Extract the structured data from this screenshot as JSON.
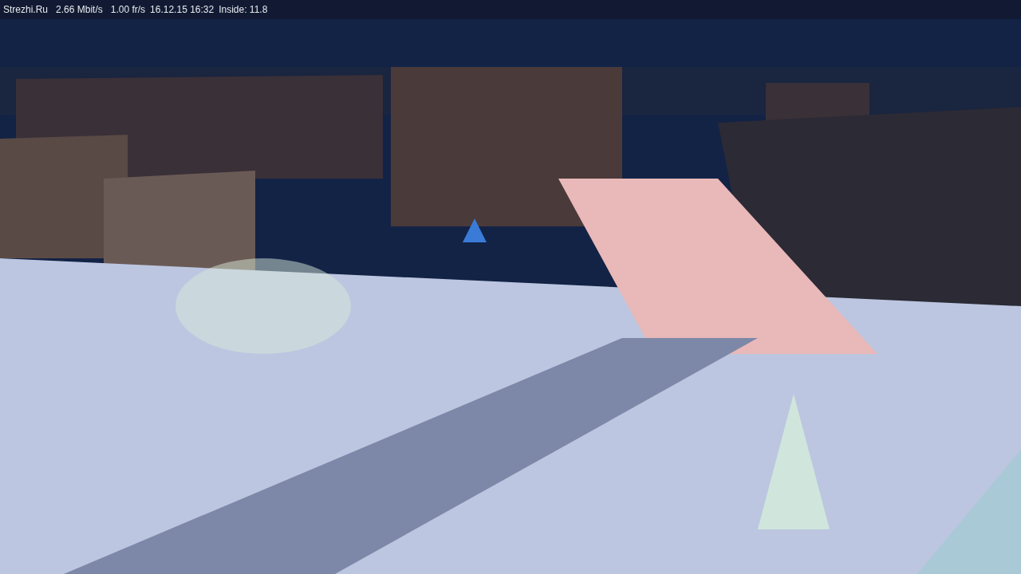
{
  "status_bar": {
    "items": [
      "Strezhi.Ru",
      "2.66 Mbit/s",
      "1.00 fr/s",
      "16.12.15 16:32",
      "Inside: 11.8"
    ]
  }
}
